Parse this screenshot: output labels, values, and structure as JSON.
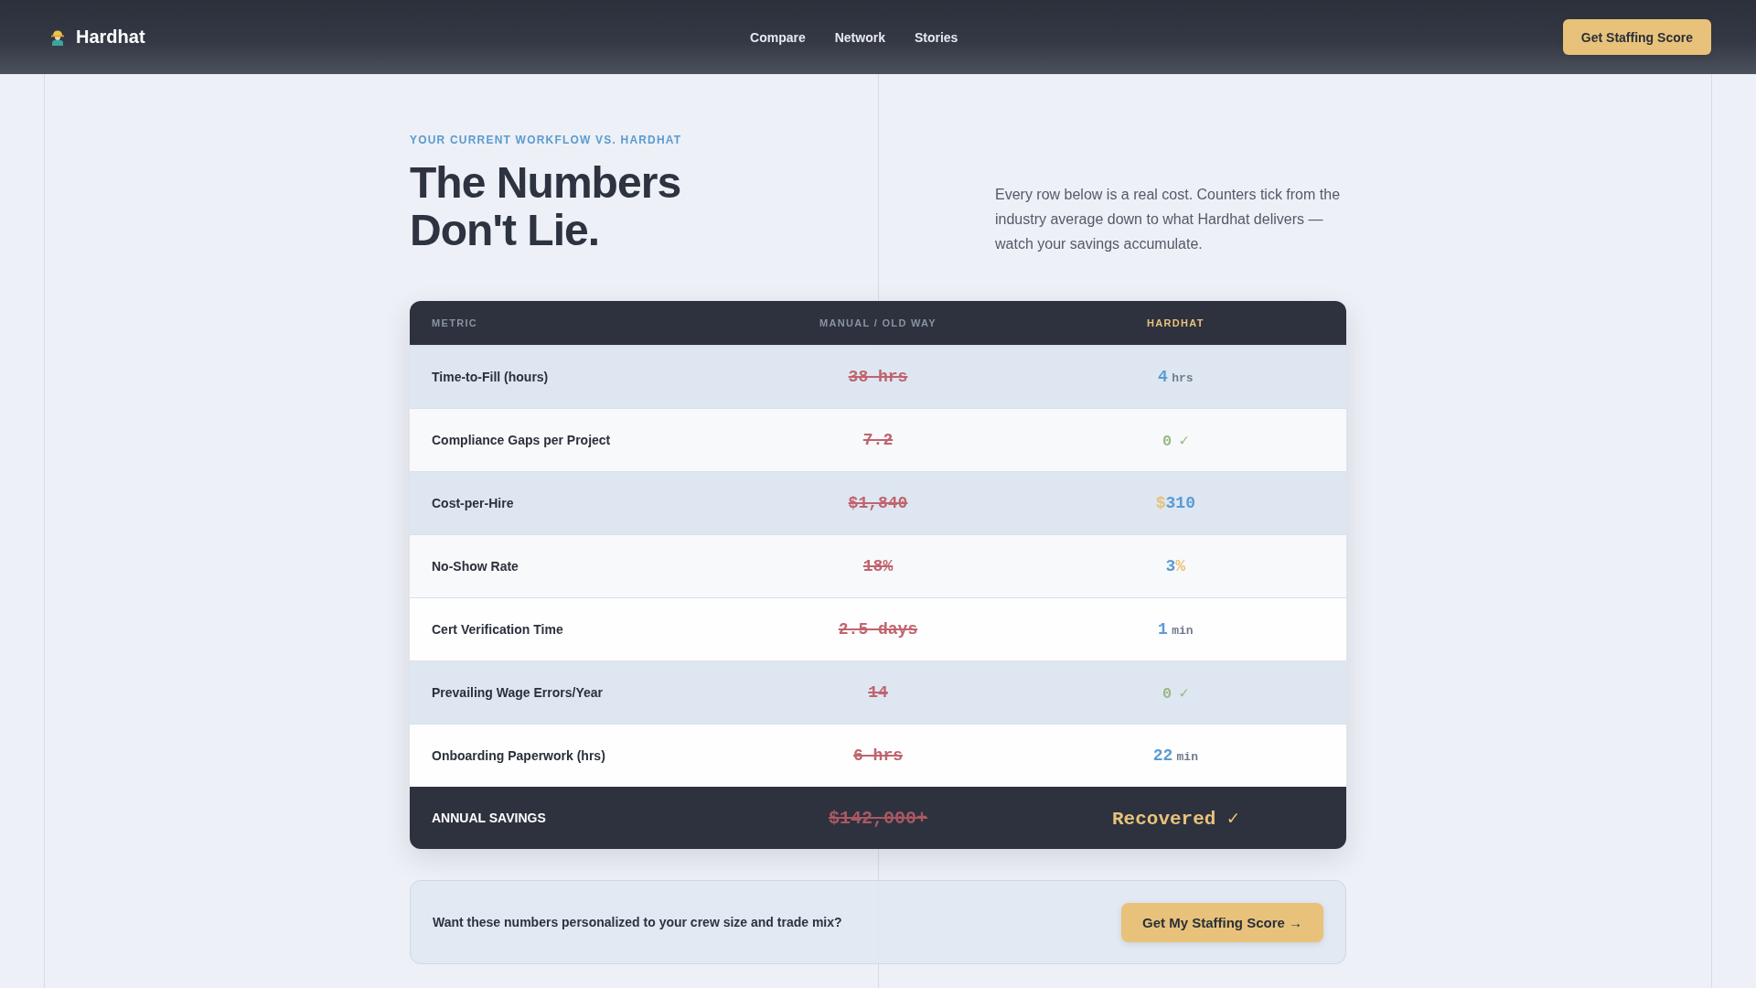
{
  "nav": {
    "brand": "Hardhat",
    "links": [
      "Compare",
      "Network",
      "Stories"
    ],
    "cta": "Get Staffing Score"
  },
  "hero": {
    "eyebrow": "YOUR CURRENT WORKFLOW VS. HARDHAT",
    "title": "The Numbers Don't Lie.",
    "description": "Every row below is a real cost. Counters tick from the industry average down to what Hardhat delivers — watch your savings accumulate."
  },
  "table": {
    "columns": [
      {
        "label": "METRIC",
        "kind": "metric"
      },
      {
        "label": "MANUAL / OLD WAY",
        "kind": "manual"
      },
      {
        "label": "HARDHAT",
        "kind": "hardhat"
      }
    ],
    "rows": [
      {
        "metric": "Time-to-Fill (hours)",
        "manual": "38 hrs",
        "highlighted": true,
        "hardhat": [
          {
            "text": "4",
            "kind": "number"
          },
          {
            "text": "hrs",
            "kind": "unit"
          }
        ]
      },
      {
        "metric": "Compliance Gaps per Project",
        "manual": "7.2",
        "highlighted": false,
        "hardhat": [
          {
            "text": "0",
            "kind": "zero"
          },
          {
            "text": "✓",
            "kind": "check"
          }
        ]
      },
      {
        "metric": "Cost-per-Hire",
        "manual": "$1,840",
        "highlighted": true,
        "hardhat": [
          {
            "text": "$",
            "kind": "symbol"
          },
          {
            "text": "310",
            "kind": "number"
          }
        ]
      },
      {
        "metric": "No-Show Rate",
        "manual": "18%",
        "highlighted": false,
        "hardhat": [
          {
            "text": "3",
            "kind": "number"
          },
          {
            "text": "%",
            "kind": "symbol"
          }
        ]
      },
      {
        "metric": "Cert Verification Time",
        "manual": "2.5 days",
        "highlighted": false,
        "hardhat": [
          {
            "text": "1",
            "kind": "number"
          },
          {
            "text": "min",
            "kind": "unit"
          }
        ]
      },
      {
        "metric": "Prevailing Wage Errors/Year",
        "manual": "14",
        "highlighted": true,
        "hardhat": [
          {
            "text": "0",
            "kind": "zero"
          },
          {
            "text": "✓",
            "kind": "check"
          }
        ]
      },
      {
        "metric": "Onboarding Paperwork (hrs)",
        "manual": "6 hrs",
        "highlighted": false,
        "hardhat": [
          {
            "text": "22",
            "kind": "number"
          },
          {
            "text": "min",
            "kind": "unit"
          }
        ]
      }
    ],
    "summary": {
      "label": "ANNUAL SAVINGS",
      "manual": "$142,000+",
      "hardhat": "Recovered ✓"
    }
  },
  "cta_panel": {
    "text": "Want these numbers personalized to your crew size and trade mix?",
    "button": "Get My Staffing Score →"
  }
}
